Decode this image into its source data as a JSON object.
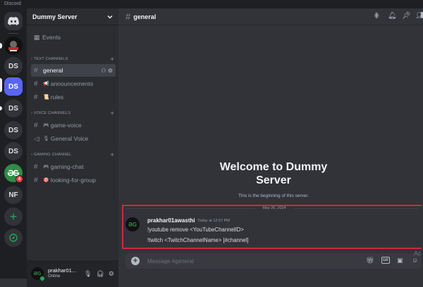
{
  "app": {
    "title": "Discord"
  },
  "rail": {
    "items": [
      {
        "label": "",
        "icon": "discord-logo-icon"
      },
      {
        "label": "",
        "icon": "server-image-icon"
      },
      {
        "label": "DS"
      },
      {
        "label": "DS",
        "active": true
      },
      {
        "label": "DS"
      },
      {
        "label": "DS"
      },
      {
        "label": "DS"
      },
      {
        "label": "GfG",
        "badge": "4"
      },
      {
        "label": "NF"
      },
      {
        "label": "+",
        "icon": "add-server-icon"
      },
      {
        "label": "",
        "icon": "explore-icon"
      }
    ]
  },
  "sidebar": {
    "server_name": "Dummy Server",
    "events_label": "Events",
    "categories": [
      {
        "name": "TEXT CHANNELS",
        "channels": [
          {
            "name": "general",
            "emoji": "",
            "selected": true
          },
          {
            "name": "announcements",
            "emoji": "📢"
          },
          {
            "name": "rules",
            "emoji": "📜"
          }
        ]
      },
      {
        "name": "VOICE CHANNELS",
        "channels": [
          {
            "name": "game-voice",
            "emoji": "🎮"
          },
          {
            "name": "General Voice",
            "emoji": "🎙"
          }
        ]
      },
      {
        "name": "GAMING CHANNEL",
        "channels": [
          {
            "name": "gaming-chat",
            "emoji": "🎮"
          },
          {
            "name": "looking-for-group",
            "emoji": "🎯"
          }
        ]
      }
    ]
  },
  "user": {
    "name": "prakhar01...",
    "status": "Online"
  },
  "channel_header": {
    "name": "general"
  },
  "welcome": {
    "title": "Welcome to Dummy Server",
    "subtitle": "This is the beginning of this server."
  },
  "date_divider": "May 26, 2024",
  "message": {
    "author": "prakhar01awasthi",
    "timestamp": "Today at 12:57 PM",
    "lines": [
      "!youtube remove <YouTubeChannelID>",
      "!twitch <TwitchChannelName> [#channel]"
    ]
  },
  "composer": {
    "placeholder": "Message #general"
  },
  "watermark": "Ac",
  "colors": {
    "brand": "#5865f2",
    "online": "#23a55a",
    "highlight_border": "#d1283d",
    "badge": "#f23f43"
  }
}
